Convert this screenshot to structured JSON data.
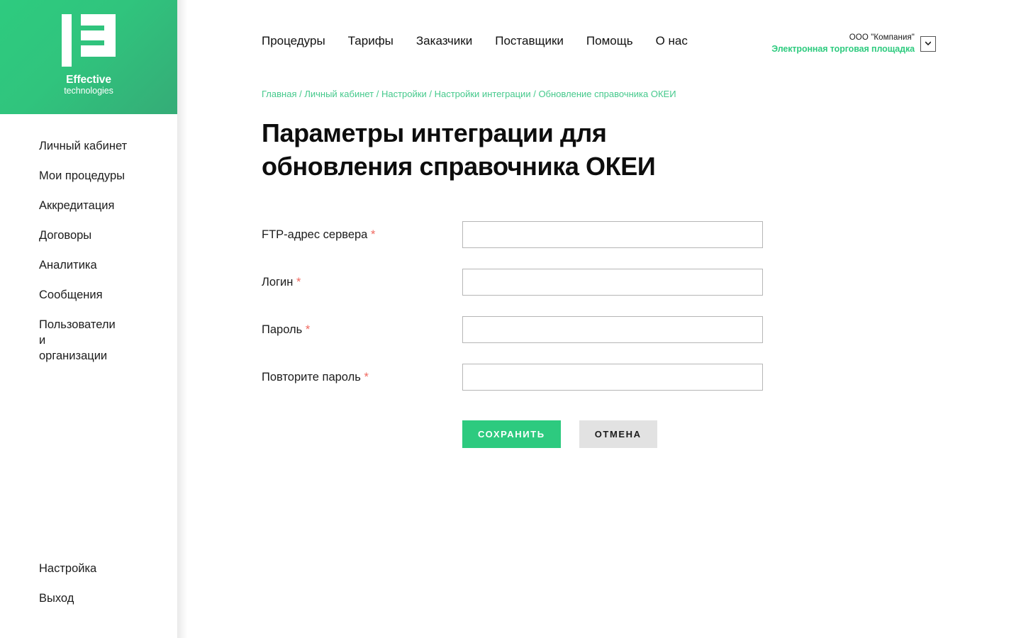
{
  "brand": {
    "logo_icon": "effective-technologies-logo",
    "name_line1": "Effective",
    "name_line2": "technologies",
    "accent_green": "#2ecb7f",
    "gradient_from": "#2ecb7f",
    "gradient_to": "#35ac77"
  },
  "topnav": {
    "items": [
      {
        "label": "Процедуры"
      },
      {
        "label": "Тарифы"
      },
      {
        "label": "Заказчики"
      },
      {
        "label": "Поставщики"
      },
      {
        "label": "Помощь"
      },
      {
        "label": "О нас"
      }
    ]
  },
  "account": {
    "company": "ООО \"Компания\"",
    "role": "Электронная торговая площадка",
    "chevron_icon": "chevron-down-icon"
  },
  "sidebar": {
    "items": [
      {
        "label": "Личный кабинет"
      },
      {
        "label": "Мои процедуры"
      },
      {
        "label": "Аккредитация"
      },
      {
        "label": "Договоры"
      },
      {
        "label": "Аналитика"
      },
      {
        "label": "Сообщения"
      },
      {
        "label": "Пользователи и организации"
      }
    ],
    "bottom_items": [
      {
        "label": "Настройка"
      },
      {
        "label": "Выход"
      }
    ]
  },
  "breadcrumb": {
    "items": [
      {
        "label": "Главная"
      },
      {
        "label": "Личный кабинет"
      },
      {
        "label": "Настройки"
      },
      {
        "label": "Настройки интеграции"
      },
      {
        "label": "Обновление справочника ОКЕИ"
      }
    ],
    "separator": "/"
  },
  "page": {
    "title": "Параметры интеграции для обновления справочника ОКЕИ"
  },
  "form": {
    "required_marker": "*",
    "fields": [
      {
        "label": "FTP-адрес сервера",
        "required": true,
        "value": "",
        "placeholder": "",
        "type": "text",
        "name": "ftp-server-address"
      },
      {
        "label": "Логин",
        "required": true,
        "value": "",
        "placeholder": "",
        "type": "text",
        "name": "login"
      },
      {
        "label": "Пароль",
        "required": true,
        "value": "",
        "placeholder": "",
        "type": "password",
        "name": "password"
      },
      {
        "label": "Повторите пароль",
        "required": true,
        "value": "",
        "placeholder": "",
        "type": "password",
        "name": "password-repeat"
      }
    ],
    "save_label": "СОХРАНИТЬ",
    "cancel_label": "ОТМЕНА"
  }
}
